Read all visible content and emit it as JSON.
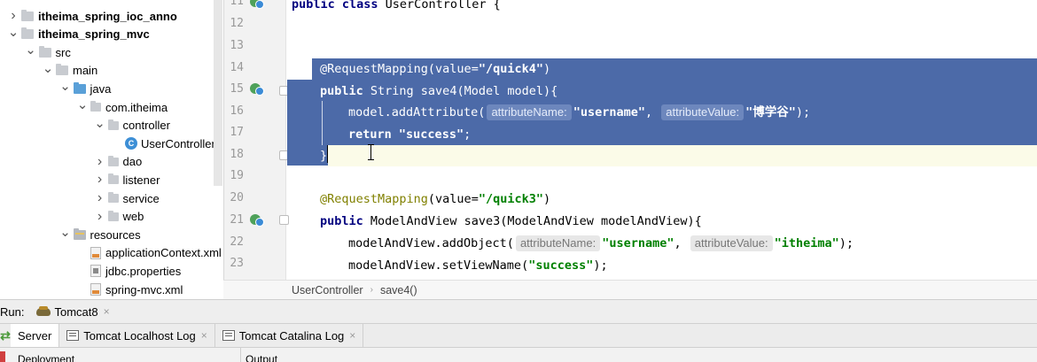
{
  "tree": {
    "items": [
      {
        "label": "itheima_spring_ioc_anno",
        "kind": "module",
        "chevron": "right",
        "indent": 0,
        "bold": true
      },
      {
        "label": "itheima_spring_mvc",
        "kind": "module",
        "chevron": "down",
        "indent": 0,
        "bold": true
      },
      {
        "label": "src",
        "kind": "folder",
        "chevron": "down",
        "indent": 1
      },
      {
        "label": "main",
        "kind": "folder",
        "chevron": "down",
        "indent": 2
      },
      {
        "label": "java",
        "kind": "folder-blue",
        "chevron": "down",
        "indent": 3
      },
      {
        "label": "com.itheima",
        "kind": "package",
        "chevron": "down",
        "indent": 4
      },
      {
        "label": "controller",
        "kind": "package",
        "chevron": "down",
        "indent": 5
      },
      {
        "label": "UserController",
        "kind": "class",
        "chevron": "",
        "indent": 6
      },
      {
        "label": "dao",
        "kind": "package",
        "chevron": "right",
        "indent": 5
      },
      {
        "label": "listener",
        "kind": "package",
        "chevron": "right",
        "indent": 5
      },
      {
        "label": "service",
        "kind": "package",
        "chevron": "right",
        "indent": 5
      },
      {
        "label": "web",
        "kind": "package",
        "chevron": "right",
        "indent": 5
      },
      {
        "label": "resources",
        "kind": "resources",
        "chevron": "down",
        "indent": 3
      },
      {
        "label": "applicationContext.xml",
        "kind": "xml",
        "chevron": "",
        "indent": 4
      },
      {
        "label": "jdbc.properties",
        "kind": "properties",
        "chevron": "",
        "indent": 4
      },
      {
        "label": "spring-mvc.xml",
        "kind": "xml",
        "chevron": "",
        "indent": 4
      }
    ]
  },
  "editor": {
    "line_numbers": [
      "11",
      "12",
      "13",
      "14",
      "15",
      "16",
      "17",
      "18",
      "19",
      "20",
      "21",
      "22",
      "23"
    ],
    "line11": {
      "kw": "public class",
      "rest": " UserController {"
    },
    "line14": {
      "anno": "@RequestMapping",
      "p1": "(value=",
      "str": "\"/quick4\"",
      "p2": ")"
    },
    "line15": {
      "kw": "public",
      "rest": " String save4(Model model){"
    },
    "line16": {
      "pre": "model.addAttribute(",
      "hint1": "attributeName:",
      "s1": "\"username\"",
      "comma": ", ",
      "hint2": "attributeValue:",
      "s2": "\"博学谷\"",
      "post": ");"
    },
    "line17": {
      "kw": "return",
      "sp": " ",
      "str": "\"success\"",
      "post": ";"
    },
    "line18": {
      "text": "}"
    },
    "line20": {
      "anno": "@RequestMapping",
      "p1": "(value=",
      "str": "\"/quick3\"",
      "p2": ")"
    },
    "line21": {
      "kw": "public",
      "rest": " ModelAndView save3(ModelAndView modelAndView){"
    },
    "line22": {
      "pre": "modelAndView.addObject(",
      "hint1": "attributeName:",
      "s1": "\"username\"",
      "comma": ", ",
      "hint2": "attributeValue:",
      "s2": "\"itheima\"",
      "post": ");"
    },
    "line23": {
      "pre": "modelAndView.setViewName(",
      "str": "\"success\"",
      "post": ");"
    }
  },
  "breadcrumb": {
    "items": [
      "UserController",
      "save4()"
    ],
    "separator": "›"
  },
  "run": {
    "label": "Run:",
    "config": "Tomcat8",
    "close": "×"
  },
  "run_tabs": [
    {
      "label": "Server",
      "active": true
    },
    {
      "label": "Tomcat Localhost Log",
      "active": false,
      "close": "×"
    },
    {
      "label": "Tomcat Catalina Log",
      "active": false,
      "close": "×"
    }
  ],
  "deploy": {
    "col1": "Deployment",
    "col2": "Output"
  },
  "colors": {
    "selection": "#4c6aa8",
    "keyword": "#000080",
    "annotation": "#808000",
    "string": "#008000"
  }
}
